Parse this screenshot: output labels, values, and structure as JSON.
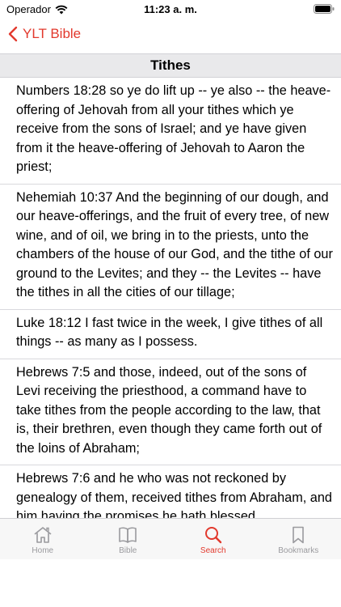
{
  "status_bar": {
    "carrier": "Operador",
    "time": "11:23 a. m."
  },
  "nav": {
    "back_label": "YLT Bible"
  },
  "section": {
    "title": "Tithes"
  },
  "verses": [
    "Numbers 18:28 so ye do lift up -- ye also -- the heave-offering of Jehovah from all your tithes which ye receive from the sons of Israel; and ye have given from it the heave-offering of Jehovah to Aaron the priest;",
    "Nehemiah 10:37 And the beginning of our dough, and our heave-offerings, and the fruit of every tree, of new wine, and of oil, we bring in to the priests, unto the chambers of the house of our God, and the tithe of our ground to the Levites; and they -- the Levites -- have the tithes in all the cities of our tillage;",
    "Luke 18:12 I fast twice in the week, I give tithes of all things -- as many as I possess.",
    "Hebrews 7:5 and those, indeed, out of the sons of Levi receiving the priesthood, a command have to take tithes from the people according to the law, that is, their brethren, even though they came forth out of the loins of Abraham;",
    "Hebrews 7:6 and he who was not reckoned by genealogy of them, received tithes from Abraham, and him having the promises he hath blessed,"
  ],
  "tabs": [
    {
      "label": "Home",
      "icon": "home-icon"
    },
    {
      "label": "Bible",
      "icon": "book-icon"
    },
    {
      "label": "Search",
      "icon": "search-icon"
    },
    {
      "label": "Bookmarks",
      "icon": "bookmark-icon"
    }
  ],
  "colors": {
    "accent": "#e2392d",
    "inactive": "#9a9a9e"
  }
}
